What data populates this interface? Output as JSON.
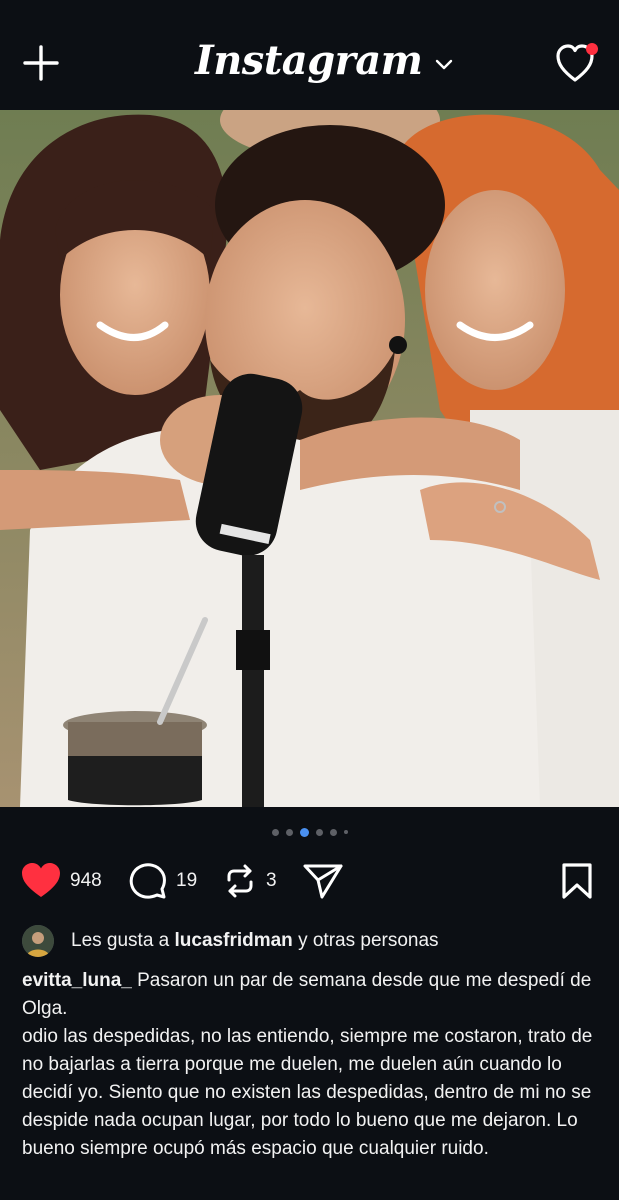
{
  "header": {
    "logo": "Instagram",
    "icons": {
      "new_post": "plus-icon",
      "account_switch": "chevron-down-icon",
      "activity": "heart-icon"
    },
    "notification_dot_color": "#ff3040"
  },
  "post": {
    "image": {
      "description_icon": "photo"
    },
    "carousel": {
      "dots": 6,
      "active_index": 2,
      "active_color": "#4a90f0"
    },
    "actions": {
      "likes": "948",
      "comments": "19",
      "reposts": "3",
      "like_color": "#ff3040"
    },
    "liked_by": {
      "prefix": "Les gusta a",
      "user": "lucasfridman",
      "suffix": "y otras personas"
    },
    "caption": {
      "username": "evitta_luna_",
      "first_line": "Pasaron un par de semana desde que me despedí de Olga.",
      "body": "odio las despedidas, no las entiendo, siempre me costaron, trato de no bajarlas a tierra porque me duelen, me duelen aún cuando lo decidí yo. Siento que no existen las despedidas, dentro de mi no se despide nada ocupan lugar, por todo lo bueno que me dejaron. Lo bueno siempre ocupó más espacio que cualquier ruido."
    }
  }
}
